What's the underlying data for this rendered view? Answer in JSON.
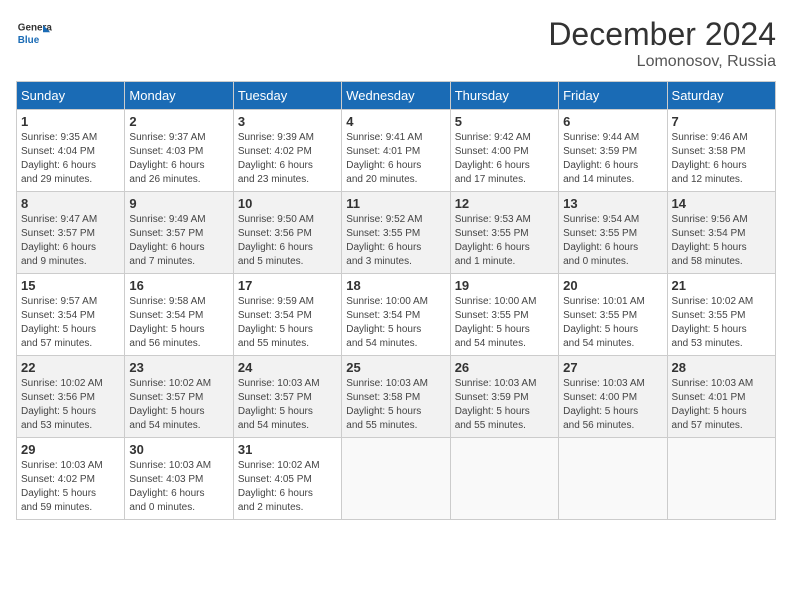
{
  "header": {
    "logo_line1": "General",
    "logo_line2": "Blue",
    "month": "December 2024",
    "location": "Lomonosov, Russia"
  },
  "weekdays": [
    "Sunday",
    "Monday",
    "Tuesday",
    "Wednesday",
    "Thursday",
    "Friday",
    "Saturday"
  ],
  "weeks": [
    [
      {
        "day": 1,
        "detail": "Sunrise: 9:35 AM\nSunset: 4:04 PM\nDaylight: 6 hours\nand 29 minutes."
      },
      {
        "day": 2,
        "detail": "Sunrise: 9:37 AM\nSunset: 4:03 PM\nDaylight: 6 hours\nand 26 minutes."
      },
      {
        "day": 3,
        "detail": "Sunrise: 9:39 AM\nSunset: 4:02 PM\nDaylight: 6 hours\nand 23 minutes."
      },
      {
        "day": 4,
        "detail": "Sunrise: 9:41 AM\nSunset: 4:01 PM\nDaylight: 6 hours\nand 20 minutes."
      },
      {
        "day": 5,
        "detail": "Sunrise: 9:42 AM\nSunset: 4:00 PM\nDaylight: 6 hours\nand 17 minutes."
      },
      {
        "day": 6,
        "detail": "Sunrise: 9:44 AM\nSunset: 3:59 PM\nDaylight: 6 hours\nand 14 minutes."
      },
      {
        "day": 7,
        "detail": "Sunrise: 9:46 AM\nSunset: 3:58 PM\nDaylight: 6 hours\nand 12 minutes."
      }
    ],
    [
      {
        "day": 8,
        "detail": "Sunrise: 9:47 AM\nSunset: 3:57 PM\nDaylight: 6 hours\nand 9 minutes."
      },
      {
        "day": 9,
        "detail": "Sunrise: 9:49 AM\nSunset: 3:57 PM\nDaylight: 6 hours\nand 7 minutes."
      },
      {
        "day": 10,
        "detail": "Sunrise: 9:50 AM\nSunset: 3:56 PM\nDaylight: 6 hours\nand 5 minutes."
      },
      {
        "day": 11,
        "detail": "Sunrise: 9:52 AM\nSunset: 3:55 PM\nDaylight: 6 hours\nand 3 minutes."
      },
      {
        "day": 12,
        "detail": "Sunrise: 9:53 AM\nSunset: 3:55 PM\nDaylight: 6 hours\nand 1 minute."
      },
      {
        "day": 13,
        "detail": "Sunrise: 9:54 AM\nSunset: 3:55 PM\nDaylight: 6 hours\nand 0 minutes."
      },
      {
        "day": 14,
        "detail": "Sunrise: 9:56 AM\nSunset: 3:54 PM\nDaylight: 5 hours\nand 58 minutes."
      }
    ],
    [
      {
        "day": 15,
        "detail": "Sunrise: 9:57 AM\nSunset: 3:54 PM\nDaylight: 5 hours\nand 57 minutes."
      },
      {
        "day": 16,
        "detail": "Sunrise: 9:58 AM\nSunset: 3:54 PM\nDaylight: 5 hours\nand 56 minutes."
      },
      {
        "day": 17,
        "detail": "Sunrise: 9:59 AM\nSunset: 3:54 PM\nDaylight: 5 hours\nand 55 minutes."
      },
      {
        "day": 18,
        "detail": "Sunrise: 10:00 AM\nSunset: 3:54 PM\nDaylight: 5 hours\nand 54 minutes."
      },
      {
        "day": 19,
        "detail": "Sunrise: 10:00 AM\nSunset: 3:55 PM\nDaylight: 5 hours\nand 54 minutes."
      },
      {
        "day": 20,
        "detail": "Sunrise: 10:01 AM\nSunset: 3:55 PM\nDaylight: 5 hours\nand 54 minutes."
      },
      {
        "day": 21,
        "detail": "Sunrise: 10:02 AM\nSunset: 3:55 PM\nDaylight: 5 hours\nand 53 minutes."
      }
    ],
    [
      {
        "day": 22,
        "detail": "Sunrise: 10:02 AM\nSunset: 3:56 PM\nDaylight: 5 hours\nand 53 minutes."
      },
      {
        "day": 23,
        "detail": "Sunrise: 10:02 AM\nSunset: 3:57 PM\nDaylight: 5 hours\nand 54 minutes."
      },
      {
        "day": 24,
        "detail": "Sunrise: 10:03 AM\nSunset: 3:57 PM\nDaylight: 5 hours\nand 54 minutes."
      },
      {
        "day": 25,
        "detail": "Sunrise: 10:03 AM\nSunset: 3:58 PM\nDaylight: 5 hours\nand 55 minutes."
      },
      {
        "day": 26,
        "detail": "Sunrise: 10:03 AM\nSunset: 3:59 PM\nDaylight: 5 hours\nand 55 minutes."
      },
      {
        "day": 27,
        "detail": "Sunrise: 10:03 AM\nSunset: 4:00 PM\nDaylight: 5 hours\nand 56 minutes."
      },
      {
        "day": 28,
        "detail": "Sunrise: 10:03 AM\nSunset: 4:01 PM\nDaylight: 5 hours\nand 57 minutes."
      }
    ],
    [
      {
        "day": 29,
        "detail": "Sunrise: 10:03 AM\nSunset: 4:02 PM\nDaylight: 5 hours\nand 59 minutes."
      },
      {
        "day": 30,
        "detail": "Sunrise: 10:03 AM\nSunset: 4:03 PM\nDaylight: 6 hours\nand 0 minutes."
      },
      {
        "day": 31,
        "detail": "Sunrise: 10:02 AM\nSunset: 4:05 PM\nDaylight: 6 hours\nand 2 minutes."
      },
      null,
      null,
      null,
      null
    ]
  ]
}
